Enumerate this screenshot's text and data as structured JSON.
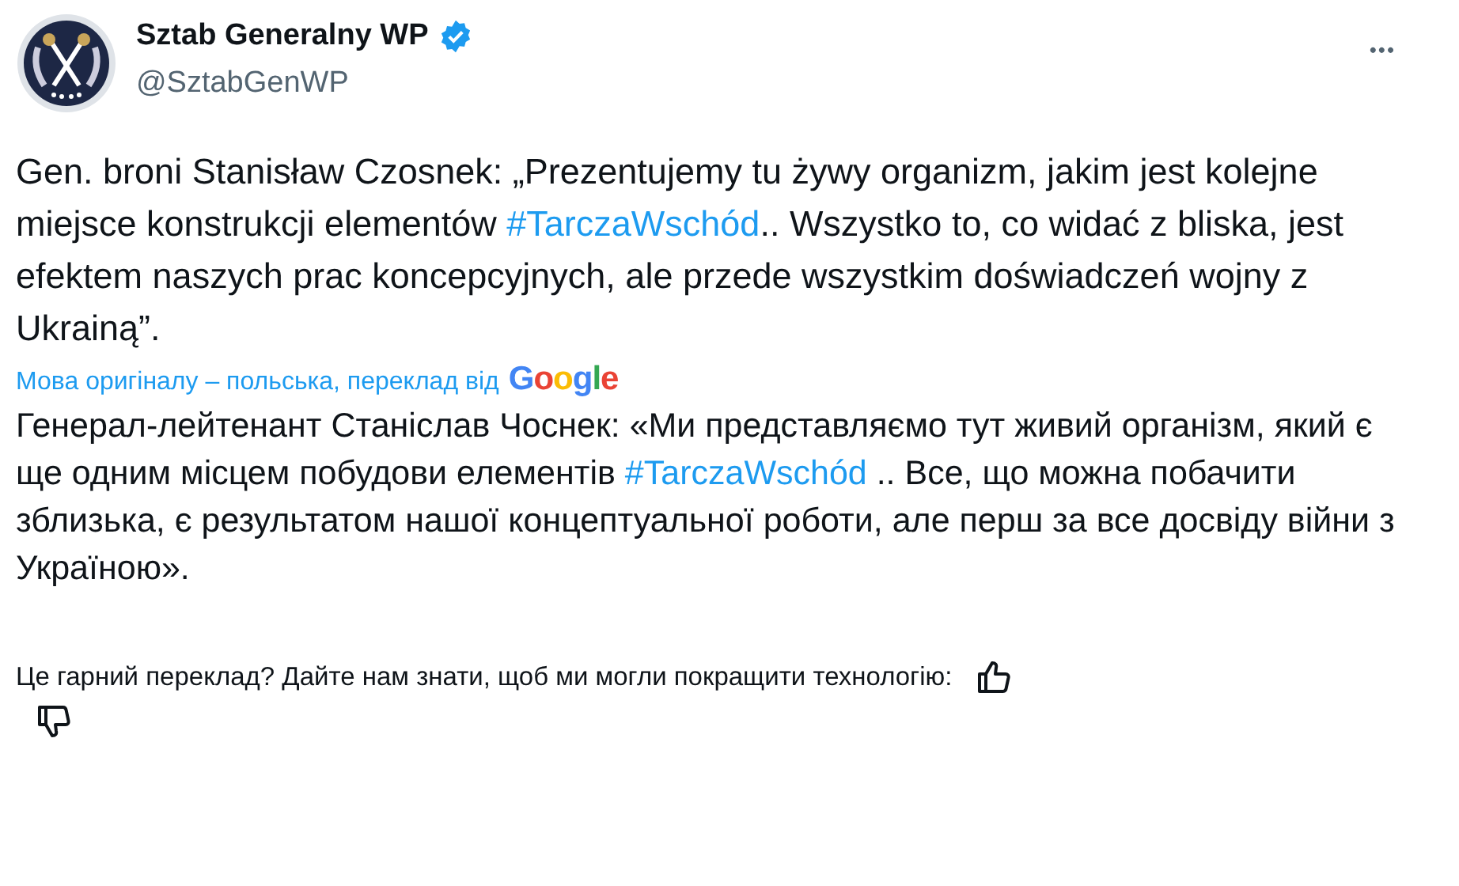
{
  "author": {
    "name": "Sztab Generalny WP",
    "verified": true,
    "handle": "@SztabGenWP"
  },
  "more_button": "•••",
  "tweet": [
    {
      "kind": "text",
      "text": "Gen. broni Stanisław Czosnek: „Prezentujemy tu żywy organizm, jakim jest kolejne miejsce konstrukcji elementów "
    },
    {
      "kind": "hashtag",
      "text": "#TarczaWschód"
    },
    {
      "kind": "text",
      "text": ".. Wszystko to, co widać z bliska, jest efektem naszych prac koncepcyjnych, ale przede wszystkim doświadczeń wojny z Ukrainą”."
    }
  ],
  "translation_note": {
    "text": "Мова оригіналу – польська, переклад від",
    "logo": "Google"
  },
  "translation": [
    {
      "kind": "text",
      "text": "Генерал-лейтенант Станіслав Чоснек: «Ми представляємо тут живий організм, який є ще одним місцем побудови елементів "
    },
    {
      "kind": "hashtag",
      "text": "#TarczaWschód"
    },
    {
      "kind": "text",
      "text": " .. Все, що можна побачити зблизька, є результатом нашої концептуальної роботи, але перш за все досвіду війни з Україною»."
    }
  ],
  "feedback": {
    "question": "Це гарний переклад? Дайте нам знати, щоб ми могли покращити технологію:"
  }
}
